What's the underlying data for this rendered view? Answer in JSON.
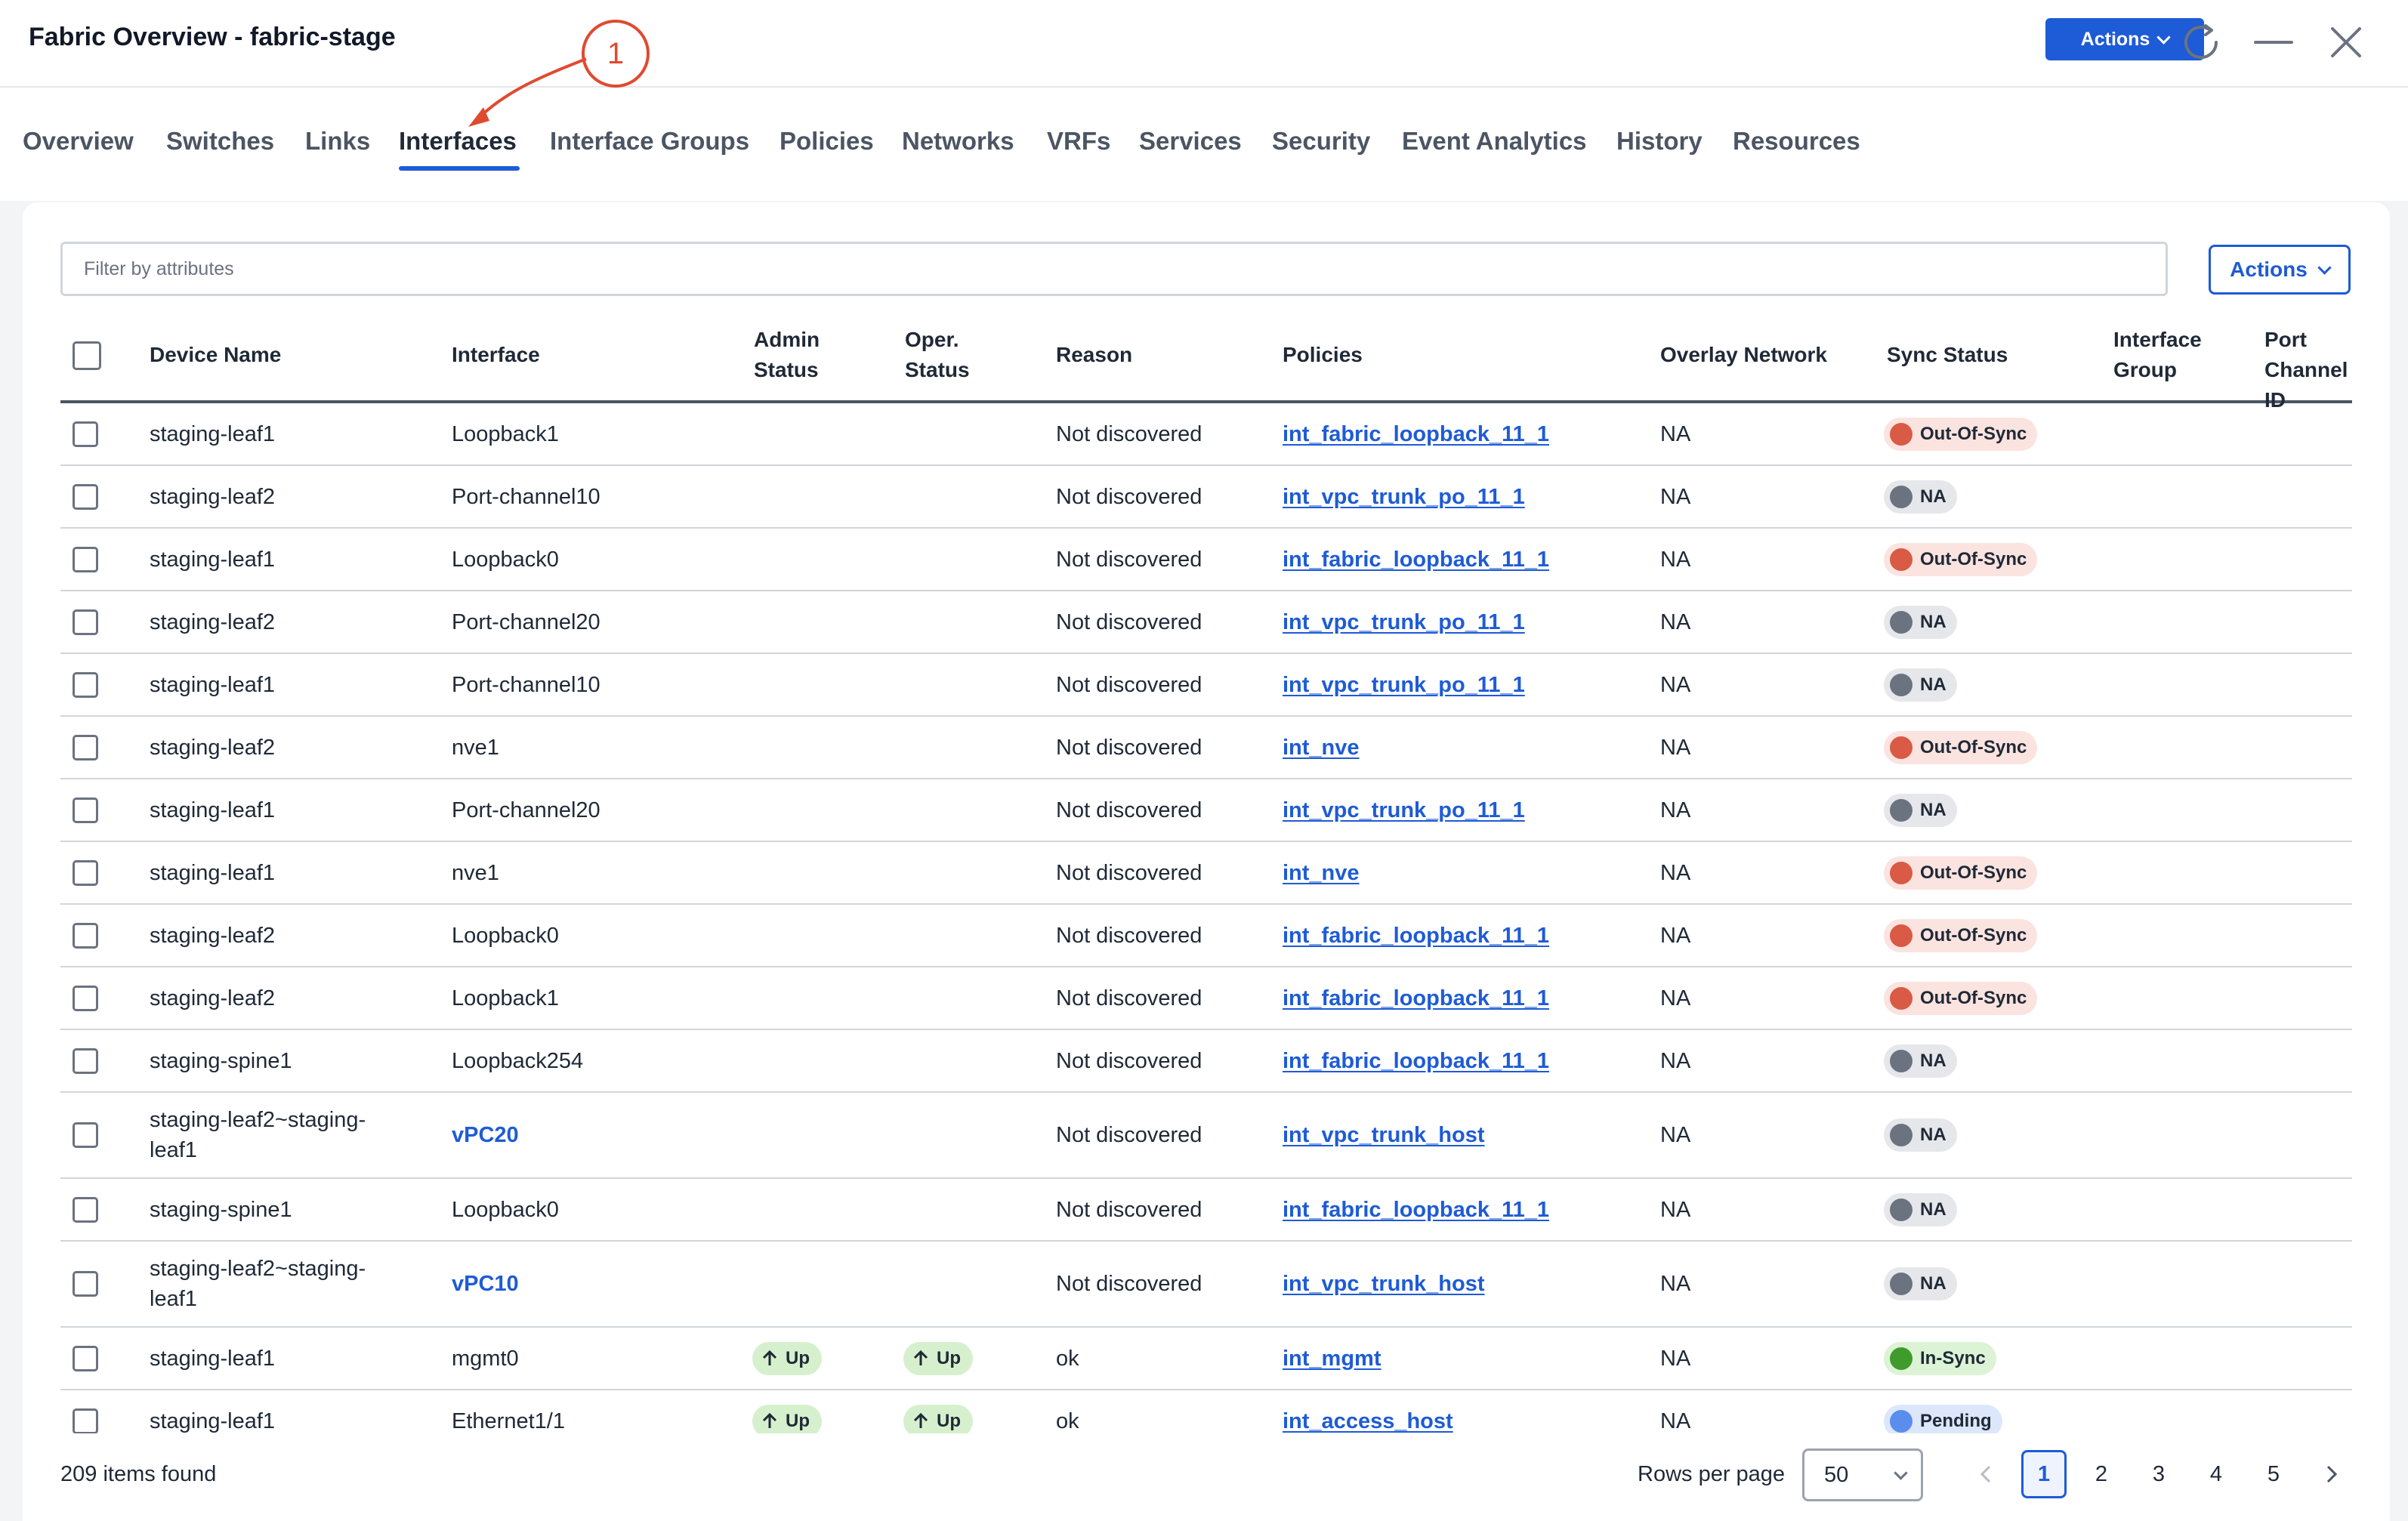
{
  "window": {
    "title": "Fabric Overview - fabric-stage",
    "actions_label": "Actions",
    "refresh_icon": "refresh-icon",
    "minimize_icon": "minimize-icon",
    "close_icon": "close-icon"
  },
  "annotation": {
    "number": "1"
  },
  "tabs": [
    {
      "label": "Overview"
    },
    {
      "label": "Switches"
    },
    {
      "label": "Links"
    },
    {
      "label": "Interfaces",
      "active": true
    },
    {
      "label": "Interface Groups"
    },
    {
      "label": "Policies"
    },
    {
      "label": "Networks"
    },
    {
      "label": "VRFs"
    },
    {
      "label": "Services"
    },
    {
      "label": "Security"
    },
    {
      "label": "Event Analytics"
    },
    {
      "label": "History"
    },
    {
      "label": "Resources"
    }
  ],
  "filter": {
    "placeholder": "Filter by attributes"
  },
  "table_actions_label": "Actions",
  "columns": {
    "device_name": "Device Name",
    "interface": "Interface",
    "admin_status_1": "Admin",
    "admin_status_2": "Status",
    "oper_status_1": "Oper.",
    "oper_status_2": "Status",
    "reason": "Reason",
    "policies": "Policies",
    "overlay_network": "Overlay Network",
    "sync_status": "Sync Status",
    "interface_group_1": "Interface",
    "interface_group_2": "Group",
    "port_channel_1": "Port",
    "port_channel_2": "Channel ID"
  },
  "rows": [
    {
      "device": "staging-leaf1",
      "interface": "Loopback1",
      "admin": "",
      "oper": "",
      "reason": "Not discovered",
      "policy": "int_fabric_loopback_11_1",
      "overlay": "NA",
      "sync": "Out-Of-Sync"
    },
    {
      "device": "staging-leaf2",
      "interface": "Port-channel10",
      "admin": "",
      "oper": "",
      "reason": "Not discovered",
      "policy": "int_vpc_trunk_po_11_1",
      "overlay": "NA",
      "sync": "NA"
    },
    {
      "device": "staging-leaf1",
      "interface": "Loopback0",
      "admin": "",
      "oper": "",
      "reason": "Not discovered",
      "policy": "int_fabric_loopback_11_1",
      "overlay": "NA",
      "sync": "Out-Of-Sync"
    },
    {
      "device": "staging-leaf2",
      "interface": "Port-channel20",
      "admin": "",
      "oper": "",
      "reason": "Not discovered",
      "policy": "int_vpc_trunk_po_11_1",
      "overlay": "NA",
      "sync": "NA"
    },
    {
      "device": "staging-leaf1",
      "interface": "Port-channel10",
      "admin": "",
      "oper": "",
      "reason": "Not discovered",
      "policy": "int_vpc_trunk_po_11_1",
      "overlay": "NA",
      "sync": "NA"
    },
    {
      "device": "staging-leaf2",
      "interface": "nve1",
      "admin": "",
      "oper": "",
      "reason": "Not discovered",
      "policy": "int_nve",
      "overlay": "NA",
      "sync": "Out-Of-Sync"
    },
    {
      "device": "staging-leaf1",
      "interface": "Port-channel20",
      "admin": "",
      "oper": "",
      "reason": "Not discovered",
      "policy": "int_vpc_trunk_po_11_1",
      "overlay": "NA",
      "sync": "NA"
    },
    {
      "device": "staging-leaf1",
      "interface": "nve1",
      "admin": "",
      "oper": "",
      "reason": "Not discovered",
      "policy": "int_nve",
      "overlay": "NA",
      "sync": "Out-Of-Sync"
    },
    {
      "device": "staging-leaf2",
      "interface": "Loopback0",
      "admin": "",
      "oper": "",
      "reason": "Not discovered",
      "policy": "int_fabric_loopback_11_1",
      "overlay": "NA",
      "sync": "Out-Of-Sync"
    },
    {
      "device": "staging-leaf2",
      "interface": "Loopback1",
      "admin": "",
      "oper": "",
      "reason": "Not discovered",
      "policy": "int_fabric_loopback_11_1",
      "overlay": "NA",
      "sync": "Out-Of-Sync"
    },
    {
      "device": "staging-spine1",
      "interface": "Loopback254",
      "admin": "",
      "oper": "",
      "reason": "Not discovered",
      "policy": "int_fabric_loopback_11_1",
      "overlay": "NA",
      "sync": "NA"
    },
    {
      "device": "staging-leaf2~staging-",
      "device2": "leaf1",
      "interface": "vPC20",
      "interface_link": true,
      "admin": "",
      "oper": "",
      "reason": "Not discovered",
      "policy": "int_vpc_trunk_host",
      "overlay": "NA",
      "sync": "NA"
    },
    {
      "device": "staging-spine1",
      "interface": "Loopback0",
      "admin": "",
      "oper": "",
      "reason": "Not discovered",
      "policy": "int_fabric_loopback_11_1",
      "overlay": "NA",
      "sync": "NA"
    },
    {
      "device": "staging-leaf2~staging-",
      "device2": "leaf1",
      "interface": "vPC10",
      "interface_link": true,
      "admin": "",
      "oper": "",
      "reason": "Not discovered",
      "policy": "int_vpc_trunk_host",
      "overlay": "NA",
      "sync": "NA"
    },
    {
      "device": "staging-leaf1",
      "interface": "mgmt0",
      "admin": "Up",
      "oper": "Up",
      "reason": "ok",
      "policy": "int_mgmt",
      "overlay": "NA",
      "sync": "In-Sync"
    },
    {
      "device": "staging-leaf1",
      "interface": "Ethernet1/1",
      "admin": "Up",
      "oper": "Up",
      "reason": "ok",
      "policy": "int_access_host",
      "overlay": "NA",
      "sync": "Pending"
    }
  ],
  "footer": {
    "items_found": "209 items found",
    "rows_per_page_label": "Rows per page",
    "rows_per_page_value": "50",
    "pages": [
      "1",
      "2",
      "3",
      "4",
      "5"
    ],
    "current_page": "1"
  },
  "colors": {
    "accent": "#1e5bd6",
    "out_of_sync": "#d95a45",
    "in_sync": "#3f9b2b",
    "pending": "#5b8def",
    "na": "#6b7280",
    "annotation": "#e04a2f"
  }
}
